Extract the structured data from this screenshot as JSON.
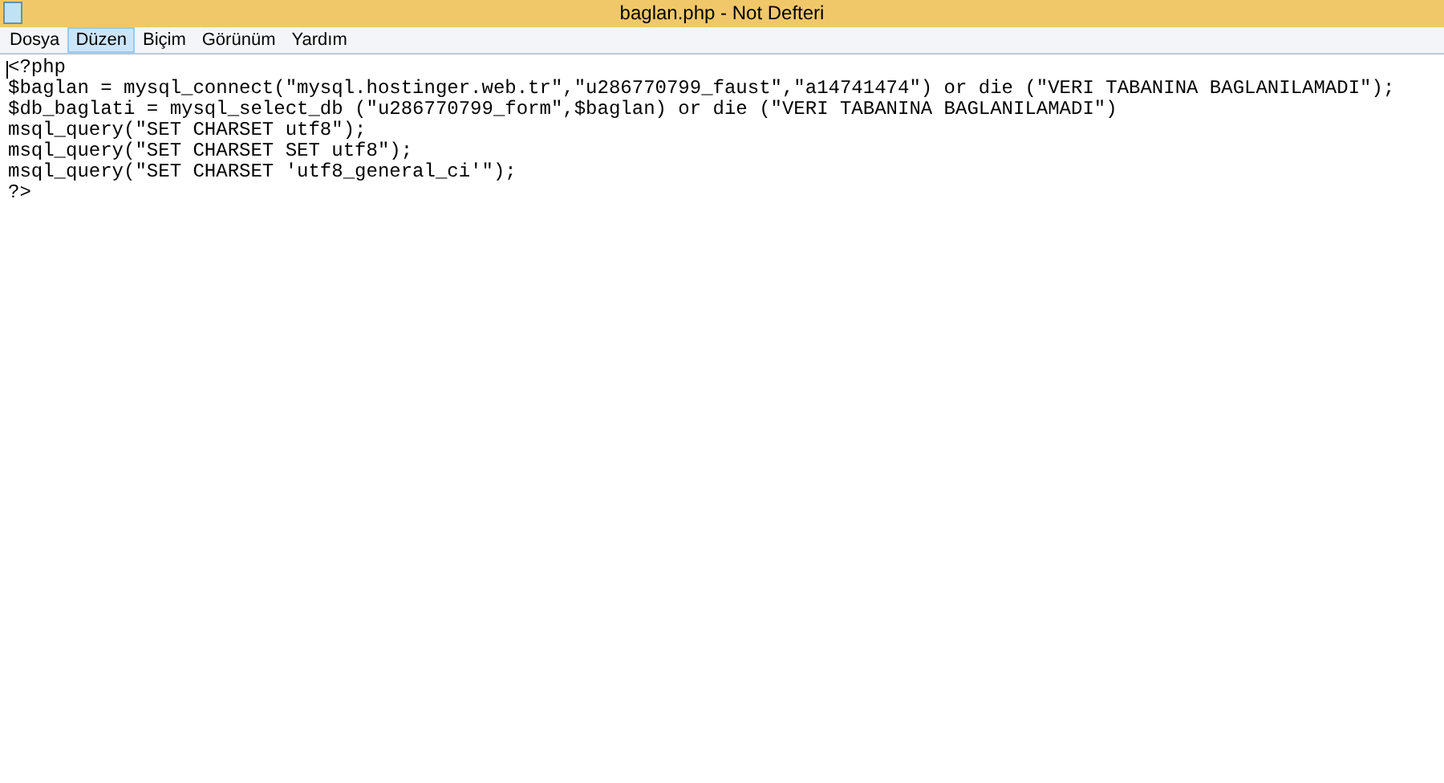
{
  "window": {
    "title": "baglan.php - Not Defteri"
  },
  "menu": [
    {
      "label": "Dosya",
      "selected": false
    },
    {
      "label": "Düzen",
      "selected": true
    },
    {
      "label": "Biçim",
      "selected": false
    },
    {
      "label": "Görünüm",
      "selected": false
    },
    {
      "label": "Yardım",
      "selected": false
    }
  ],
  "editor": {
    "lines": [
      "<?php",
      "$baglan = mysql_connect(\"mysql.hostinger.web.tr\",\"u286770799_faust\",\"a14741474\") or die (\"VERI TABANINA BAGLANILAMADI\");",
      "$db_baglati = mysql_select_db (\"u286770799_form\",$baglan) or die (\"VERI TABANINA BAGLANILAMADI\")",
      "msql_query(\"SET CHARSET utf8\");",
      "msql_query(\"SET CHARSET SET utf8\");",
      "msql_query(\"SET CHARSET 'utf8_general_ci'\");",
      "?>"
    ]
  }
}
